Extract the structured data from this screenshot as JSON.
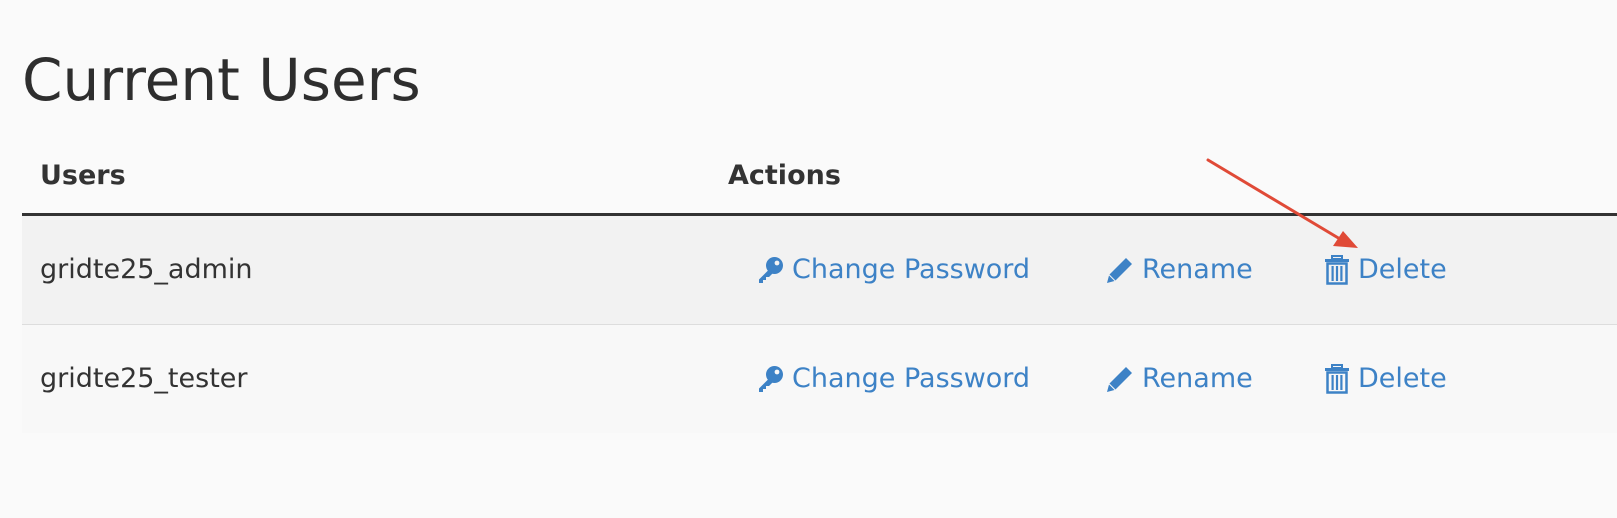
{
  "page": {
    "title": "Current Users"
  },
  "table": {
    "headers": {
      "users": "Users",
      "actions": "Actions"
    },
    "rows": [
      {
        "user": "gridte25_admin",
        "change_password": "Change Password",
        "rename": "Rename",
        "delete": "Delete"
      },
      {
        "user": "gridte25_tester",
        "change_password": "Change Password",
        "rename": "Rename",
        "delete": "Delete"
      }
    ]
  },
  "icons": {
    "change_password": "key-icon",
    "rename": "pencil-icon",
    "delete": "trash-icon"
  },
  "colors": {
    "link": "#3d82c6",
    "annotation_arrow": "#e04a37",
    "header_rule": "#333333"
  }
}
